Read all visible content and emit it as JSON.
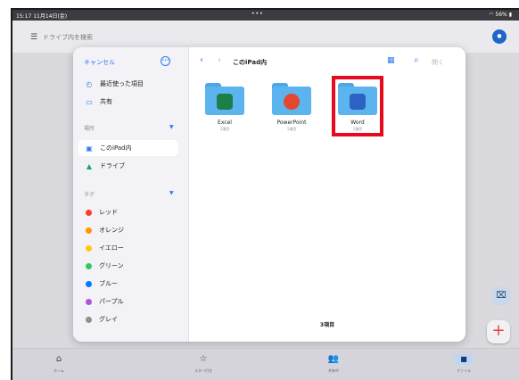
{
  "status_bar": {
    "time": "15:17 11月14日(金)",
    "dots": "•••",
    "battery": "56%"
  },
  "drive": {
    "search_placeholder": "ドライブ内を検索"
  },
  "picker": {
    "cancel_label": "キャンセル",
    "recent_label": "最近使った項目",
    "shared_label": "共有",
    "locations_header": "場所",
    "locations": [
      {
        "label": "このiPad内",
        "selected": true
      },
      {
        "label": "ドライブ",
        "selected": false
      }
    ],
    "tags_header": "タグ",
    "tags": [
      {
        "label": "レッド",
        "color": "#ff3b30"
      },
      {
        "label": "オレンジ",
        "color": "#ff9500"
      },
      {
        "label": "イエロー",
        "color": "#ffcc00"
      },
      {
        "label": "グリーン",
        "color": "#34c759"
      },
      {
        "label": "ブルー",
        "color": "#007aff"
      },
      {
        "label": "パープル",
        "color": "#af52de"
      },
      {
        "label": "グレイ",
        "color": "#8e8e93"
      }
    ],
    "location_title": "このiPad内",
    "open_label": "開く",
    "folders": [
      {
        "name": "Excel",
        "count": "1項目",
        "badge_color": "#1d7f47"
      },
      {
        "name": "PowerPoint",
        "count": "1項目",
        "badge_color": "#e2482f"
      },
      {
        "name": "Word",
        "count": "1項目",
        "badge_color": "#2b62c3"
      }
    ],
    "item_count": "3項目"
  },
  "bottom_nav": [
    {
      "label": "ホーム",
      "icon": "home-icon",
      "glyph": "⌂"
    },
    {
      "label": "スター付き",
      "icon": "star-icon",
      "glyph": "☆"
    },
    {
      "label": "共有中",
      "icon": "shared-people-icon",
      "glyph": "👥"
    },
    {
      "label": "ファイル",
      "icon": "folder-icon",
      "glyph": "■"
    }
  ]
}
